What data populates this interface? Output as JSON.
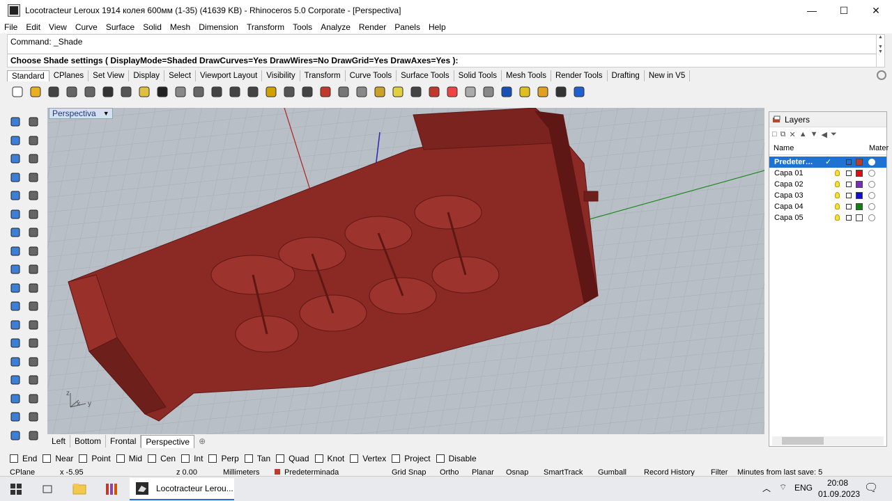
{
  "window": {
    "title": "Locotracteur Leroux 1914 колея 600мм (1-35) (41639 KB) - Rhinoceros  5.0 Corporate - [Perspectiva]",
    "minimize": "—",
    "maximize": "☐",
    "close": "✕"
  },
  "menu": [
    "File",
    "Edit",
    "View",
    "Curve",
    "Surface",
    "Solid",
    "Mesh",
    "Dimension",
    "Transform",
    "Tools",
    "Analyze",
    "Render",
    "Panels",
    "Help"
  ],
  "command": {
    "history": "Command: _Shade",
    "prompt": "Choose Shade settings ( DisplayMode=Shaded  DrawCurves=Yes  DrawWires=No  DrawGrid=Yes  DrawAxes=Yes ):"
  },
  "toolbar_tabs": [
    "Standard",
    "CPlanes",
    "Set View",
    "Display",
    "Select",
    "Viewport Layout",
    "Visibility",
    "Transform",
    "Curve Tools",
    "Surface Tools",
    "Solid Tools",
    "Mesh Tools",
    "Render Tools",
    "Drafting",
    "New in V5"
  ],
  "toolbar_icons": [
    "new-icon",
    "open-icon",
    "save-icon",
    "print-icon",
    "import-icon",
    "cut-icon",
    "copy-icon",
    "paste-icon",
    "undo-icon",
    "pan-icon",
    "move-view-icon",
    "zoom-icon",
    "zoom-window-icon",
    "zoom-extents-icon",
    "zoom-selected-icon",
    "rotate-view-icon",
    "four-viewports-icon",
    "car-icon",
    "camera-icon",
    "grid-icon",
    "snap-icon",
    "bulb-icon",
    "lock-icon",
    "shield-icon",
    "color-wheel-icon",
    "sphere-gray-icon",
    "sphere-dark-icon",
    "sphere-blue-icon",
    "paint-icon",
    "gear-icon",
    "options-icon",
    "help-icon"
  ],
  "viewport": {
    "name": "Perspectiva",
    "axis_x": "x",
    "axis_y": "y",
    "axis_z": "z"
  },
  "viewport_tabs": [
    "Left",
    "Bottom",
    "Frontal",
    "Perspective"
  ],
  "viewport_tabs_add": "⊕",
  "layers": {
    "title": "Layers",
    "col_name": "Name",
    "col_material": "Mater",
    "items": [
      {
        "name": "Predeter…",
        "color": "#c0392b",
        "selected": true
      },
      {
        "name": "Capa 01",
        "color": "#d81010"
      },
      {
        "name": "Capa 02",
        "color": "#7b2cbf"
      },
      {
        "name": "Capa 03",
        "color": "#1010d0"
      },
      {
        "name": "Capa 04",
        "color": "#108010"
      },
      {
        "name": "Capa 05",
        "color": "#ffffff"
      }
    ]
  },
  "osnaps": [
    "End",
    "Near",
    "Point",
    "Mid",
    "Cen",
    "Int",
    "Perp",
    "Tan",
    "Quad",
    "Knot",
    "Vertex",
    "Project",
    "Disable"
  ],
  "status": {
    "cplane": "CPlane",
    "x": "x -5.95",
    "z": "z 0.00",
    "units": "Millimeters",
    "layer": "Predeterminada",
    "gridsnap": "Grid Snap",
    "ortho": "Ortho",
    "planar": "Planar",
    "osnap": "Osnap",
    "smarttrack": "SmartTrack",
    "gumball": "Gumball",
    "history": "Record History",
    "filter": "Filter",
    "lastsave": "Minutes from last save: 5"
  },
  "taskbar": {
    "app_label": "Locotracteur Lerou...",
    "lang": "ENG",
    "time": "20:08",
    "date": "01.09.2023"
  },
  "colors": {
    "model": "#8b2a25",
    "model_dark": "#5e1714",
    "viewport_bg": "#b9bfc7",
    "selection": "#1e73d2"
  }
}
